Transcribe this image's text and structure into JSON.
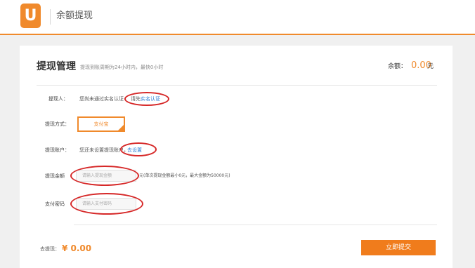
{
  "app": {
    "logo_letter": "U",
    "title": "余额提现"
  },
  "card": {
    "title": "提现管理",
    "subtitle": "提现到账周期为24小时内，最快0小时",
    "balance_label": "余额：",
    "balance_value": "0.00",
    "balance_unit": "元"
  },
  "form": {
    "payee_label": "提现人：",
    "payee_text": "您尚未通过实名认证",
    "payee_link_prefix": "请先",
    "payee_link": "实名认证",
    "method_label": "提现方式：",
    "method_option": "支付宝",
    "account_label": "提现账户：",
    "account_text": "您还未设置提现账户，",
    "account_link": "去设置",
    "amount_label": "提现金额",
    "amount_placeholder": "请输入提现金额",
    "amount_hint": "元(单次提现金额最小0元，最大金额为50000元)",
    "password_label": "支付密码",
    "password_placeholder": "请输入支付密码"
  },
  "footer": {
    "withdraw_label": "去提现：",
    "withdraw_amount": "¥ 0.00",
    "submit_label": "立即提交"
  },
  "colors": {
    "accent": "#f08a2c",
    "annotation_red": "#d62828",
    "link": "#2f7fd6"
  },
  "icons": {
    "logo": "u-logo-icon",
    "payment_selected": "selected-corner-icon"
  }
}
